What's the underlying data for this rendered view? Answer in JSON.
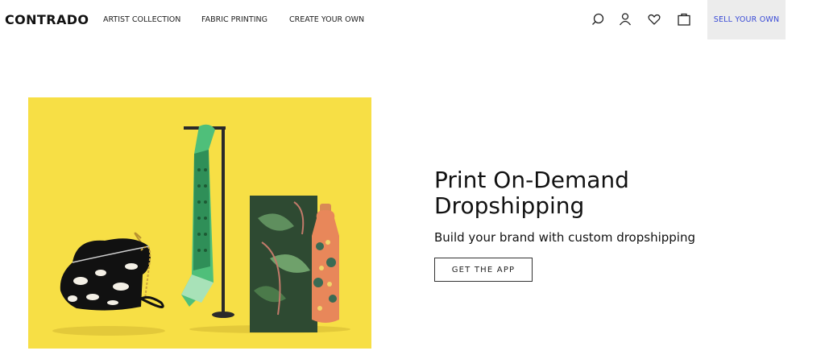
{
  "header": {
    "logo": "CONTRADO",
    "nav": [
      "ARTIST COLLECTION",
      "FABRIC PRINTING",
      "CREATE YOUR OWN"
    ],
    "icons": [
      "search-icon",
      "account-icon",
      "wishlist-heart-icon",
      "basket-icon"
    ],
    "sell_label": "SELL YOUR OWN"
  },
  "hero": {
    "title_line1": "Print On-Demand",
    "title_line2": "Dropshipping",
    "subtitle": "Build your brand with custom dropshipping",
    "cta_label": "GET THE APP",
    "image_bg": "#f7df45"
  },
  "colors": {
    "accent_link": "#3a4bd6",
    "sell_bg": "#ececec"
  }
}
